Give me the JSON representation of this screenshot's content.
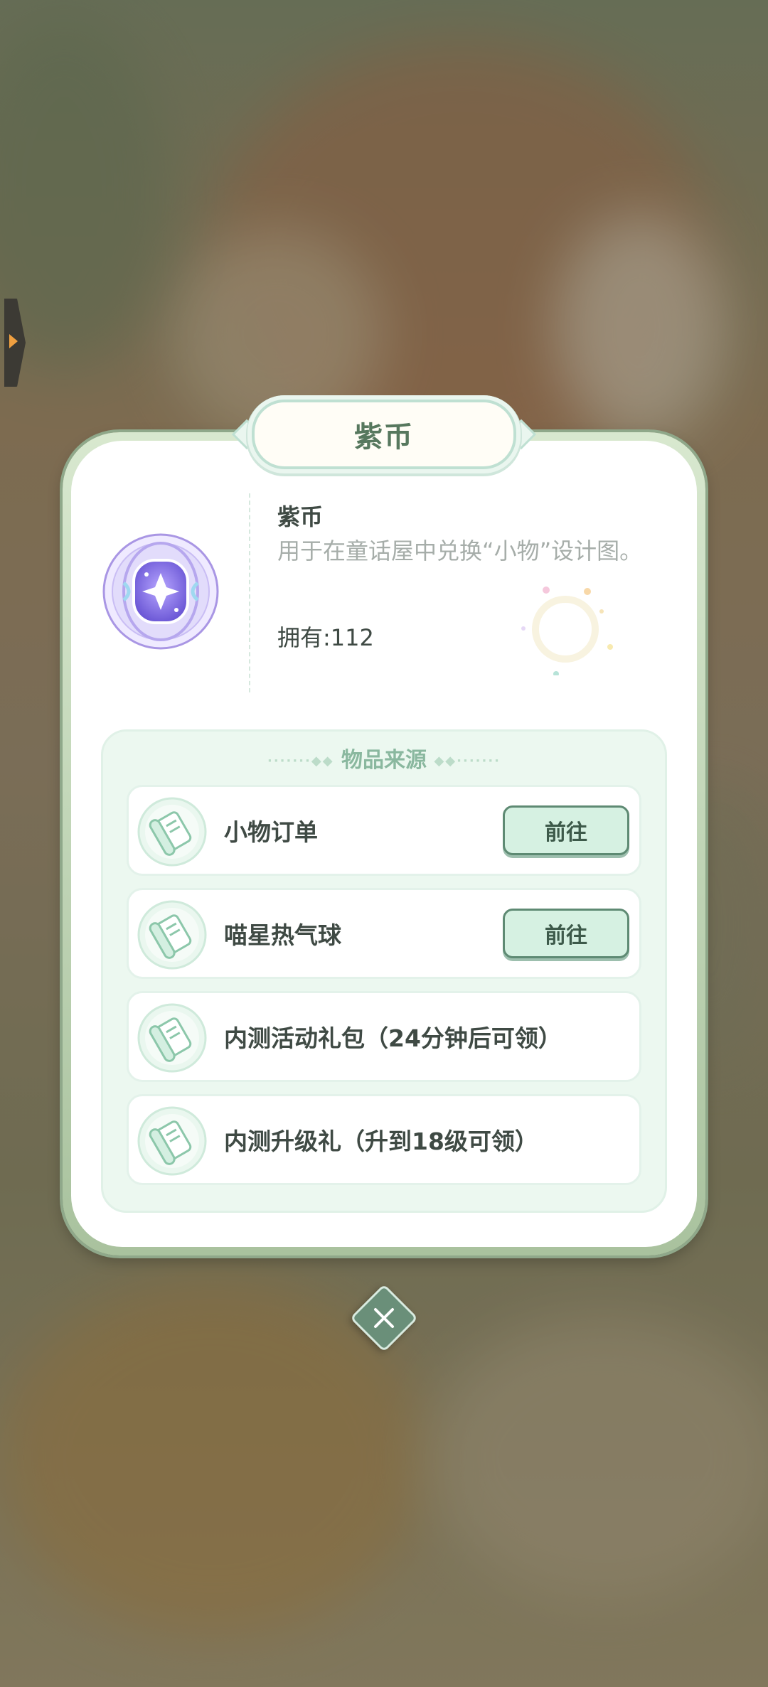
{
  "popup": {
    "title": "紫币"
  },
  "item": {
    "name": "紫币",
    "description": "用于在童话屋中兑换“小物”设计图。",
    "owned_label": "拥有",
    "owned_separator": ":",
    "owned_count": "112",
    "icon": "purple-coin-icon"
  },
  "sources": {
    "title": "物品来源",
    "rows": [
      {
        "label": "小物订单",
        "button": "前往",
        "icon": "scroll-icon"
      },
      {
        "label": "喵星热气球",
        "button": "前往",
        "icon": "scroll-icon"
      },
      {
        "label": "内测活动礼包（24分钟后可领）",
        "icon": "scroll-icon"
      },
      {
        "label": "内测升级礼（升到18级可领）",
        "icon": "scroll-icon"
      }
    ]
  },
  "colors": {
    "accent_green": "#57785e",
    "button_fill": "#d6f1e2",
    "panel_fill": "#ecf8f0",
    "coin_purple": "#7b66e0"
  }
}
